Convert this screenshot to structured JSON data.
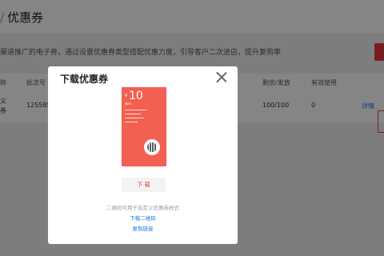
{
  "breadcrumb": {
    "separator": "/",
    "title": "优惠券"
  },
  "description": "渠道推广的电子券，通过设置优惠券类型搭配优惠力度，引导客户二次进店，提升复购率",
  "table": {
    "headers": [
      "称",
      "批次号",
      "剩余/发放",
      "有效使用"
    ],
    "row": {
      "name_line1": "义",
      "name_line2": "券",
      "batch": "125585(",
      "remain": "100/100",
      "used": "0",
      "action": "详情"
    }
  },
  "modal": {
    "title": "下载优惠券",
    "coupon": {
      "currency": "¥",
      "amount": "10",
      "condition": "满99"
    },
    "download_label": "下 载",
    "hint": "二维码可用于自定义优惠券样式",
    "qr_link": "下载二维码",
    "copy_link": "复制链接"
  },
  "colors": {
    "accent": "#e23b3b",
    "coupon": "#f35f50",
    "link": "#1a73e8"
  },
  "icons": {
    "close": "close-icon",
    "qr": "qr-code-icon"
  }
}
